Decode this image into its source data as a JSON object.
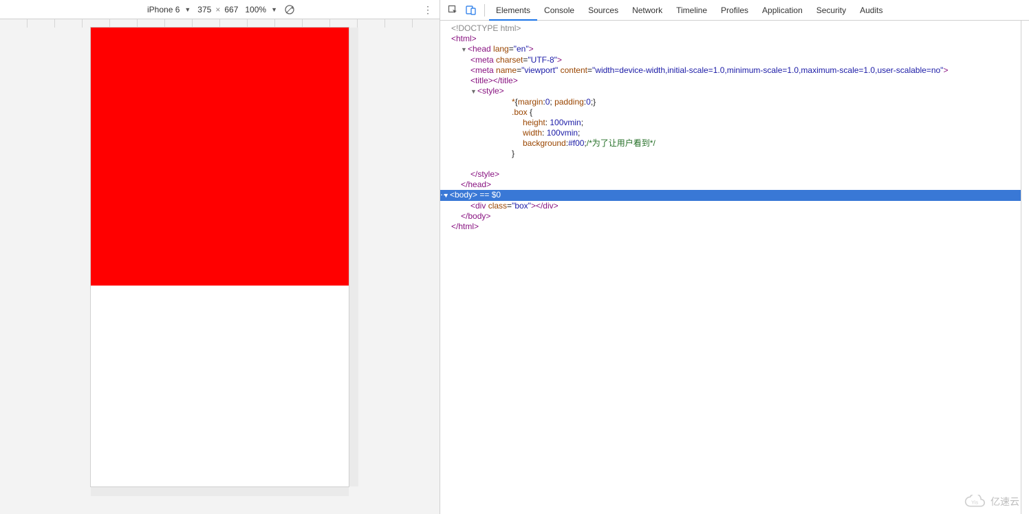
{
  "devicebar": {
    "device": "iPhone 6",
    "width": "375",
    "sep": "×",
    "height": "667",
    "zoom": "100%"
  },
  "tabs": [
    "Elements",
    "Console",
    "Sources",
    "Network",
    "Timeline",
    "Profiles",
    "Application",
    "Security",
    "Audits"
  ],
  "active_tab": 0,
  "dom": {
    "doctype": "<!DOCTYPE html>",
    "html_open": "<html>",
    "head_open": "<head lang=\"en\">",
    "meta_charset": "<meta charset=\"UTF-8\">",
    "meta_viewport_pre": "<meta name=\"viewport\" content=",
    "meta_viewport_val": "\"width=device-width,initial-scale=1.0,minimum-scale=1.0,maximum-scale=1.0,user-scalable=no\"",
    "meta_viewport_post": ">",
    "title": "<title></title>",
    "style_open": "<style>",
    "css_reset": "*{margin:0; padding:0;}",
    "css_box_sel": ".box {",
    "css_height": "height: 100vmin;",
    "css_width": "width: 100vmin;",
    "css_bg": "background:#f00;",
    "css_comment": "/*为了让用户看到*/",
    "css_close": "}",
    "style_close": "</style>",
    "head_close": "</head>",
    "body_open": "<body>",
    "body_eq": " == $0",
    "div_box": "<div class=\"box\"></div>",
    "body_close": "</body>",
    "html_close": "</html>"
  },
  "watermark": "亿速云"
}
